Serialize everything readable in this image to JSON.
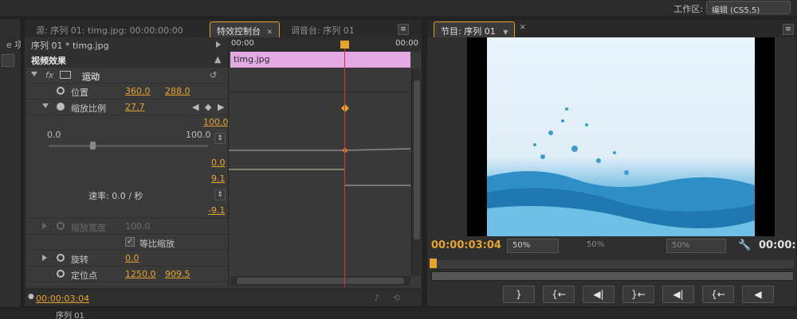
{
  "topbar": {
    "workspace_label": "工作区:",
    "workspace_value": "编辑 (CS5.5)"
  },
  "left_panel": {
    "tab_label": "e 项"
  },
  "effect_controls": {
    "tabs": [
      {
        "label": "源: 序列 01: timg.jpg: 00:00:00:00",
        "active": false
      },
      {
        "label": "特效控制台",
        "active": true
      },
      {
        "label": "调音台: 序列 01",
        "active": false
      }
    ],
    "sequence_clip": "序列 01 * timg.jpg",
    "ruler_start": "00:00",
    "ruler_end": "00:00",
    "clip_name": "timg.jpg",
    "section_title": "视频效果",
    "motion": {
      "fx_label": "fx",
      "name": "运动",
      "position": {
        "label": "位置",
        "x": "360.0",
        "y": "288.0"
      },
      "scale": {
        "label": "缩放比例",
        "value": "27.7",
        "slider_min": "0.0",
        "slider_max": "100.0",
        "graph_top": "100.0",
        "graph_mid": "0.0",
        "velocity_top": "9.1",
        "velocity_label": "速率: 0.0 / 秒",
        "velocity_bottom": "-9.1"
      },
      "scale_width": {
        "label": "缩放宽度",
        "value": "100.0"
      },
      "uniform_scale": {
        "label": "等比缩放",
        "checked": true
      },
      "rotation": {
        "label": "旋转",
        "value": "0.0"
      },
      "anchor": {
        "label": "定位点",
        "x": "1250.0",
        "y": "909.5"
      }
    },
    "current_time": "00:00:03:04"
  },
  "program_monitor": {
    "tab_label": "节目: 序列 01",
    "timecode": "00:00:03:04",
    "zoom": "50%",
    "quality_left": "50%",
    "quality_right": "50%",
    "duration": "00:00:",
    "transport": [
      "}",
      "{←",
      "◀|",
      "}←",
      "◀|",
      "{←",
      "◀"
    ]
  },
  "bottom": {
    "sequence_tab": "序列 01"
  },
  "colors": {
    "accent": "#e6a52a",
    "clip": "#e3a9e3",
    "playhead": "#d8332d"
  }
}
